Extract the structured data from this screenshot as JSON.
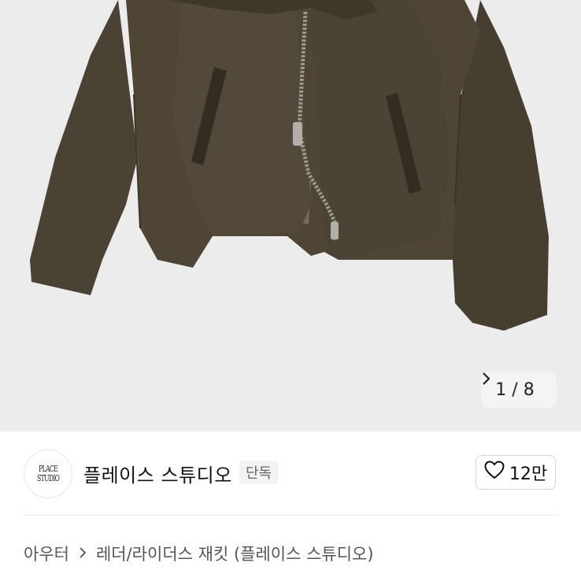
{
  "gallery": {
    "counter_current": "1",
    "counter_sep": "/",
    "counter_total": "8",
    "next_icon": "chevron-right-icon"
  },
  "brand": {
    "logo_line1": "PLACE",
    "logo_line2": "STUDIO",
    "name": "플레이스 스튜디오",
    "badge": "단독",
    "like_icon": "heart-icon",
    "like_count": "12만"
  },
  "breadcrumb": {
    "category": "아우터",
    "separator_icon": "chevron-right-icon",
    "subcategory": "레더/라이더스 재킷 (플레이스 스튜디오)"
  },
  "colors": {
    "jacket": "#4a4232",
    "background": "#ececec"
  }
}
